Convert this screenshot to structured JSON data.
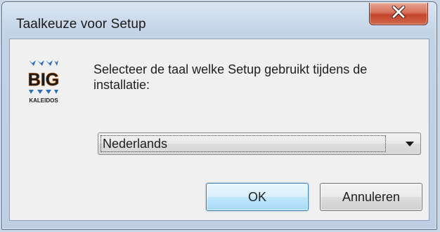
{
  "window": {
    "title": "Taalkeuze voor Setup"
  },
  "titlebar": {
    "close_icon": "close-x-icon"
  },
  "logo": {
    "word": "BIG",
    "caption": "KALEIDOS"
  },
  "prompt": {
    "text": "Selecteer de taal welke Setup gebruikt tijdens de installatie:"
  },
  "language_select": {
    "selected": "Nederlands",
    "arrow_icon": "chevron-down-icon"
  },
  "buttons": {
    "ok_label": "OK",
    "cancel_label": "Annuleren"
  },
  "colors": {
    "close_button": "#c4442b",
    "logo_blue": "#2f6fb5",
    "logo_orange": "#f07a1a",
    "ok_border": "#3c7fb1"
  }
}
